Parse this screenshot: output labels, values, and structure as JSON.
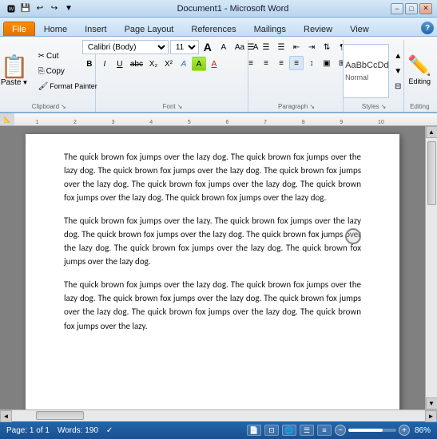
{
  "titleBar": {
    "title": "Document1 - Microsoft Word",
    "minimizeLabel": "−",
    "maximizeLabel": "□",
    "closeLabel": "✕",
    "quickAccess": [
      "💾",
      "↩",
      "↪",
      "▼"
    ]
  },
  "tabs": {
    "items": [
      "File",
      "Home",
      "Insert",
      "Page Layout",
      "References",
      "Mailings",
      "Review",
      "View"
    ],
    "active": "Home"
  },
  "ribbon": {
    "groups": {
      "clipboard": {
        "label": "Clipboard",
        "pasteLabel": "Paste"
      },
      "font": {
        "label": "Font",
        "fontName": "Calibri (Body)",
        "fontSize": "11",
        "boldLabel": "B",
        "italicLabel": "I",
        "underlineLabel": "U",
        "strikeLabel": "abc",
        "subscriptLabel": "X₂",
        "superscriptLabel": "X²",
        "changeCaseLabel": "Aa",
        "clearLabel": "A",
        "highlightLabel": "A",
        "fontColorLabel": "A",
        "growLabel": "A↑",
        "shrinkLabel": "A↓"
      },
      "paragraph": {
        "label": "Paragraph",
        "bullets": "≡",
        "numbering": "≡",
        "multilevel": "≡",
        "decreaseIndent": "←",
        "increaseIndent": "→",
        "sort": "↕",
        "showHide": "¶",
        "alignLeft": "≡",
        "center": "≡",
        "alignRight": "≡",
        "justify": "≡",
        "lineSpacing": "↕",
        "shading": "▣",
        "borders": "⊞"
      },
      "styles": {
        "label": "Styles",
        "normalLabel": "AaBbCcDd",
        "normal": "Normal"
      },
      "editing": {
        "label": "Editing",
        "icon": "✏",
        "editingLabel": "Editing"
      }
    }
  },
  "document": {
    "paragraphs": [
      "The quick brown fox jumps over the lazy dog. The quick brown fox jumps over the lazy dog. The quick brown fox jumps over the lazy dog. The quick brown fox jumps over the lazy dog. The quick brown fox jumps over the lazy dog. The quick brown fox jumps over the lazy dog. The quick brown fox jumps over the lazy dog.",
      "The quick brown fox jumps over the lazy. The quick brown fox jumps over the lazy dog. The quick brown fox jumps over the lazy dog. The quick brown fox jumps over the lazy dog. The quick brown fox jumps over the lazy dog. The quick brown fox jumps over the lazy dog.",
      "The quick brown fox jumps over the lazy dog. The quick brown fox jumps over the lazy dog. The quick brown fox jumps over the lazy dog. The quick brown fox jumps over the lazy dog. The quick brown fox jumps over the lazy dog. The quick brown fox jumps over the lazy."
    ]
  },
  "statusBar": {
    "page": "Page: 1 of 1",
    "words": "Words: 190",
    "checkMark": "✓",
    "zoom": "86%",
    "zoomMinus": "−",
    "zoomPlus": "+"
  }
}
